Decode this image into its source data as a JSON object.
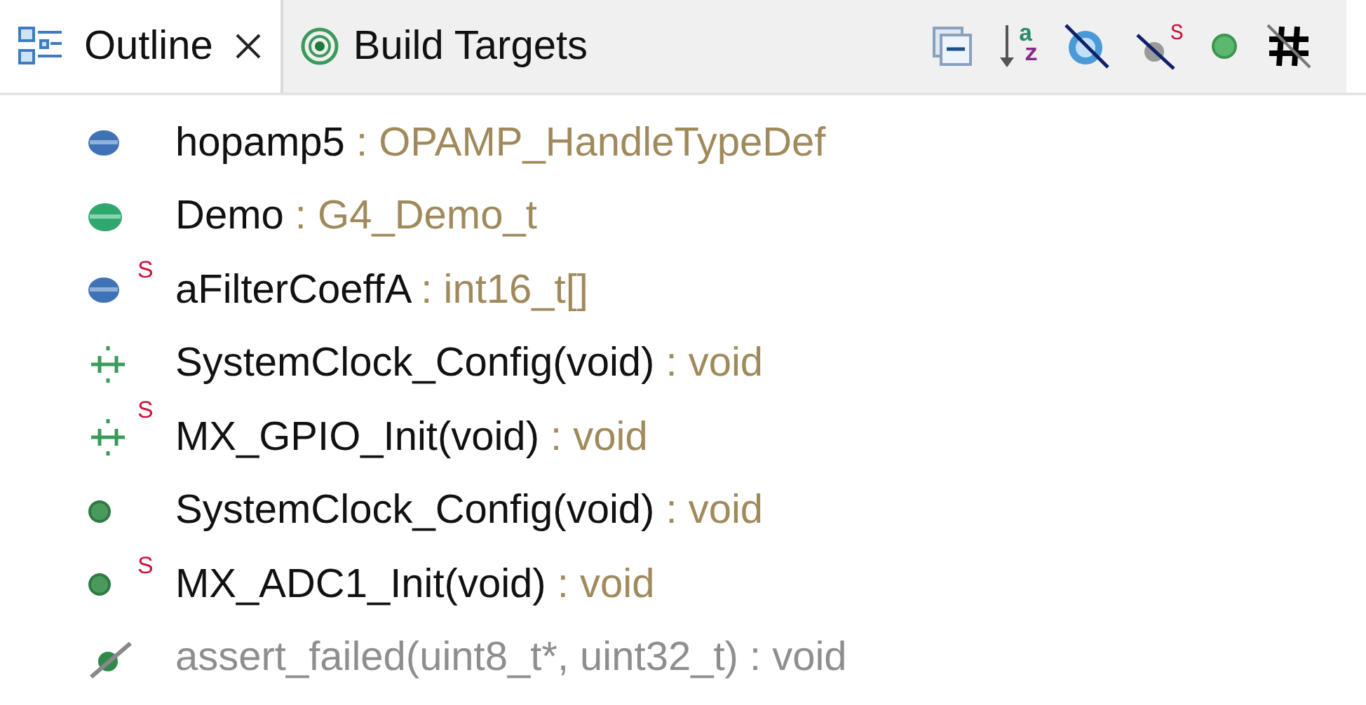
{
  "tabs": [
    {
      "label": "Outline",
      "selected": true,
      "closable": true,
      "kind": "outline"
    },
    {
      "label": "Build Targets",
      "selected": false,
      "closable": false,
      "kind": "targets"
    }
  ],
  "toolbar": [
    {
      "kind": "collapse"
    },
    {
      "kind": "sort",
      "letters": [
        "a",
        "z"
      ]
    },
    {
      "kind": "hide-fields"
    },
    {
      "kind": "hide-static",
      "letters": [
        "S"
      ]
    },
    {
      "kind": "hide-nonpublic"
    },
    {
      "kind": "hide-defines"
    }
  ],
  "items": [
    {
      "kind": "field-blue",
      "static": false,
      "name": "hopamp5",
      "type": " : OPAMP_HandleTypeDef",
      "inactive": false
    },
    {
      "kind": "field-green",
      "static": false,
      "name": "Demo",
      "type": " : G4_Demo_t",
      "inactive": false
    },
    {
      "kind": "field-blue",
      "static": true,
      "badge": "S",
      "name": "aFilterCoeffA",
      "type": " : int16_t[]",
      "inactive": false
    },
    {
      "kind": "declaration",
      "static": false,
      "name": "SystemClock_Config(void)",
      "type": " : void",
      "inactive": false
    },
    {
      "kind": "declaration",
      "static": true,
      "badge": "S",
      "name": "MX_GPIO_Init(void)",
      "type": " : void",
      "inactive": false
    },
    {
      "kind": "function",
      "static": false,
      "name": "SystemClock_Config(void)",
      "type": " : void",
      "inactive": false
    },
    {
      "kind": "function",
      "static": true,
      "badge": "S",
      "name": "MX_ADC1_Init(void)",
      "type": " : void",
      "inactive": false
    },
    {
      "kind": "function-excluded",
      "static": false,
      "name": "assert_failed(uint8_t*, uint32_t)",
      "type": " : void",
      "inactive": true
    }
  ]
}
